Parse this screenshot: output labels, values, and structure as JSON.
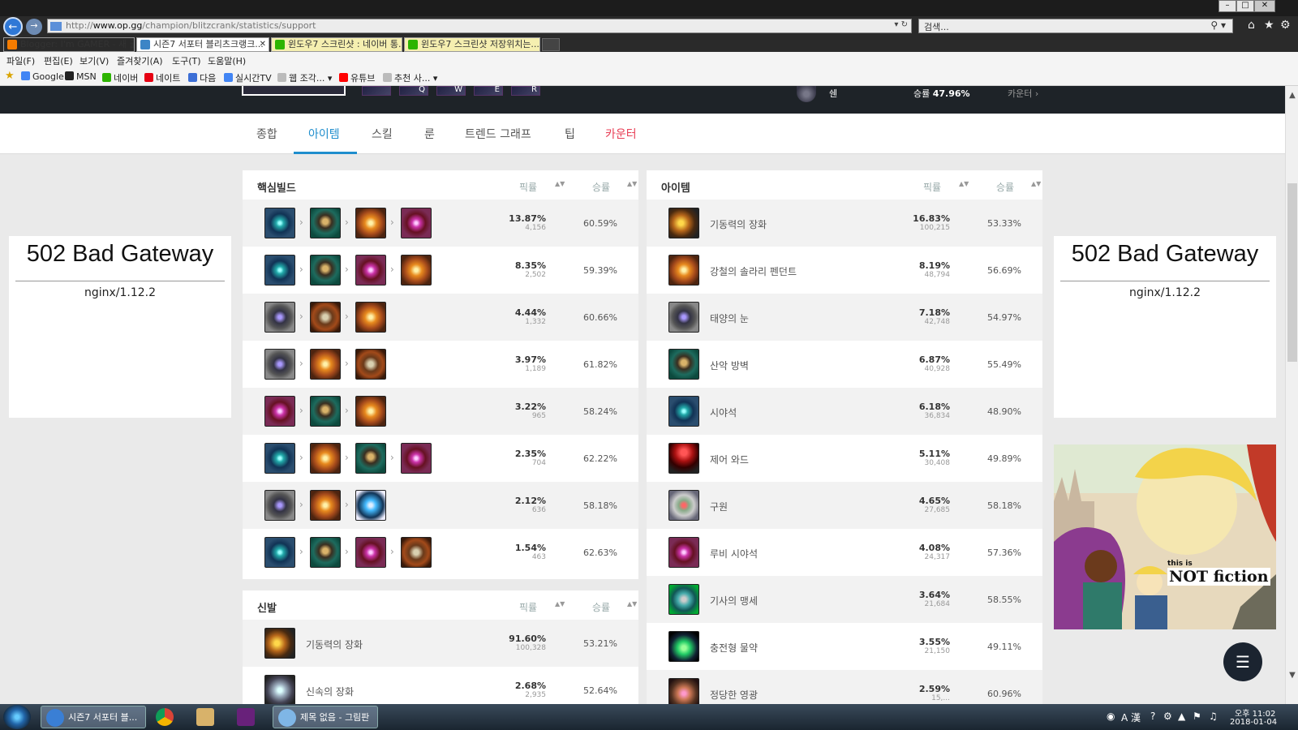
{
  "browser": {
    "url_prefix": "http://",
    "url_host": "www.op.gg",
    "url_path": "/champion/blitzcrank/statistics/support",
    "search_placeholder": "검색...",
    "tabs": [
      {
        "label": "Blogger: I'm GAMER - 새 글",
        "icon_color": "#f57c00",
        "bg": "#e9e9e9"
      },
      {
        "label": "시즌7 서포터 블리츠크랭크...",
        "icon_color": "#3d85c6",
        "bg": "#ffffff"
      },
      {
        "label": "윈도우7 스크린샷 : 네이버 통...",
        "icon_color": "#2db400",
        "bg": "#f5efb0"
      },
      {
        "label": "윈도우7 스크린샷 저장위치는...",
        "icon_color": "#2db400",
        "bg": "#f5efb0"
      }
    ],
    "menu": [
      "파일(F)",
      "편집(E)",
      "보기(V)",
      "즐겨찾기(A)",
      "도구(T)",
      "도움말(H)"
    ],
    "favorites": [
      {
        "label": "Google",
        "icon_color": "#4285f4"
      },
      {
        "label": "MSN",
        "icon_color": "#222222"
      },
      {
        "label": "네이버",
        "icon_color": "#2db400"
      },
      {
        "label": "네이트",
        "icon_color": "#e60012"
      },
      {
        "label": "다음",
        "icon_color": "#3d6fd6"
      },
      {
        "label": "실시간TV",
        "icon_color": "#4285f4"
      },
      {
        "label": "웹 조각...",
        "icon_color": "#888888"
      },
      {
        "label": "유튜브",
        "icon_color": "#ff0000"
      },
      {
        "label": "추천 사...",
        "icon_color": "#888888"
      }
    ]
  },
  "champion_header": {
    "skills": [
      "Q",
      "W",
      "E",
      "R"
    ],
    "counter_name": "쉔",
    "counter_winrate_label": "승률",
    "counter_winrate": "47.96%",
    "counter_link": "카운터"
  },
  "subnav": {
    "tabs": [
      "종합",
      "아이템",
      "스킬",
      "룬",
      "트렌드 그래프",
      "팁",
      "카운터"
    ]
  },
  "core_build": {
    "title": "핵심빌드",
    "pick_header": "픽률",
    "win_header": "승률",
    "rows": [
      {
        "items": [
          "eye-blue",
          "aegis",
          "solari",
          "eye-ruby"
        ],
        "pick": "13.87%",
        "count": "4,156",
        "win": "60.59%"
      },
      {
        "items": [
          "eye-blue",
          "aegis",
          "eye-ruby",
          "solari"
        ],
        "pick": "8.35%",
        "count": "2,502",
        "win": "59.39%"
      },
      {
        "items": [
          "eye-sun",
          "helm",
          "solari"
        ],
        "pick": "4.44%",
        "count": "1,332",
        "win": "60.66%"
      },
      {
        "items": [
          "eye-sun",
          "solari",
          "helm"
        ],
        "pick": "3.97%",
        "count": "1,189",
        "win": "61.82%"
      },
      {
        "items": [
          "eye-ruby",
          "aegis",
          "solari"
        ],
        "pick": "3.22%",
        "count": "965",
        "win": "58.24%"
      },
      {
        "items": [
          "eye-blue",
          "solari",
          "aegis",
          "eye-ruby"
        ],
        "pick": "2.35%",
        "count": "704",
        "win": "62.22%"
      },
      {
        "items": [
          "eye-sun",
          "solari",
          "orb"
        ],
        "pick": "2.12%",
        "count": "636",
        "win": "58.18%"
      },
      {
        "items": [
          "eye-blue",
          "aegis",
          "eye-ruby",
          "helm"
        ],
        "pick": "1.54%",
        "count": "463",
        "win": "62.63%"
      }
    ]
  },
  "boots": {
    "title": "신발",
    "pick_header": "픽률",
    "win_header": "승률",
    "rows": [
      {
        "icon": "boots",
        "name": "기동력의 장화",
        "pick": "91.60%",
        "count": "100,328",
        "win": "53.21%"
      },
      {
        "icon": "swift",
        "name": "신속의 장화",
        "pick": "2.68%",
        "count": "2,935",
        "win": "52.64%"
      }
    ]
  },
  "items": {
    "title": "아이템",
    "pick_header": "픽률",
    "win_header": "승률",
    "rows": [
      {
        "icon": "boots",
        "name": "기동력의 장화",
        "pick": "16.83%",
        "count": "100,215",
        "win": "53.33%"
      },
      {
        "icon": "solari",
        "name": "강철의 솔라리 펜던트",
        "pick": "8.19%",
        "count": "48,794",
        "win": "56.69%"
      },
      {
        "icon": "eye-sun",
        "name": "태양의 눈",
        "pick": "7.18%",
        "count": "42,748",
        "win": "54.97%"
      },
      {
        "icon": "aegis",
        "name": "산악 방벽",
        "pick": "6.87%",
        "count": "40,928",
        "win": "55.49%"
      },
      {
        "icon": "eye-blue",
        "name": "시야석",
        "pick": "6.18%",
        "count": "36,834",
        "win": "48.90%"
      },
      {
        "icon": "ward",
        "name": "제어 와드",
        "pick": "5.11%",
        "count": "30,408",
        "win": "49.89%"
      },
      {
        "icon": "redeem",
        "name": "구원",
        "pick": "4.65%",
        "count": "27,685",
        "win": "58.18%"
      },
      {
        "icon": "eye-ruby",
        "name": "루비 시야석",
        "pick": "4.08%",
        "count": "24,317",
        "win": "57.36%"
      },
      {
        "icon": "knight",
        "name": "기사의 맹세",
        "pick": "3.64%",
        "count": "21,684",
        "win": "58.55%"
      },
      {
        "icon": "potion",
        "name": "충전형 물약",
        "pick": "3.55%",
        "count": "21,150",
        "win": "49.11%"
      },
      {
        "icon": "harrow",
        "name": "정당한 영광",
        "pick": "2.59%",
        "count": "15,...",
        "win": "60.96%"
      }
    ]
  },
  "ads": {
    "error_title": "502 Bad Gateway",
    "error_server": "nginx/1.12.2",
    "art_text_this_is": "this is",
    "art_text_brand": "NOT fiction"
  },
  "taskbar": {
    "tasks": [
      {
        "label": "시즌7 서포터 블...",
        "color": "#3a7fd5"
      },
      {
        "label": "",
        "color": "#e8b21a"
      },
      {
        "label": "",
        "color": "#d8b26a"
      },
      {
        "label": "",
        "color": "#68217a"
      },
      {
        "label": "제목 없음 - 그림판",
        "color": "#7fb6e6"
      }
    ],
    "time": "오후 11:02",
    "date": "2018-01-04"
  }
}
